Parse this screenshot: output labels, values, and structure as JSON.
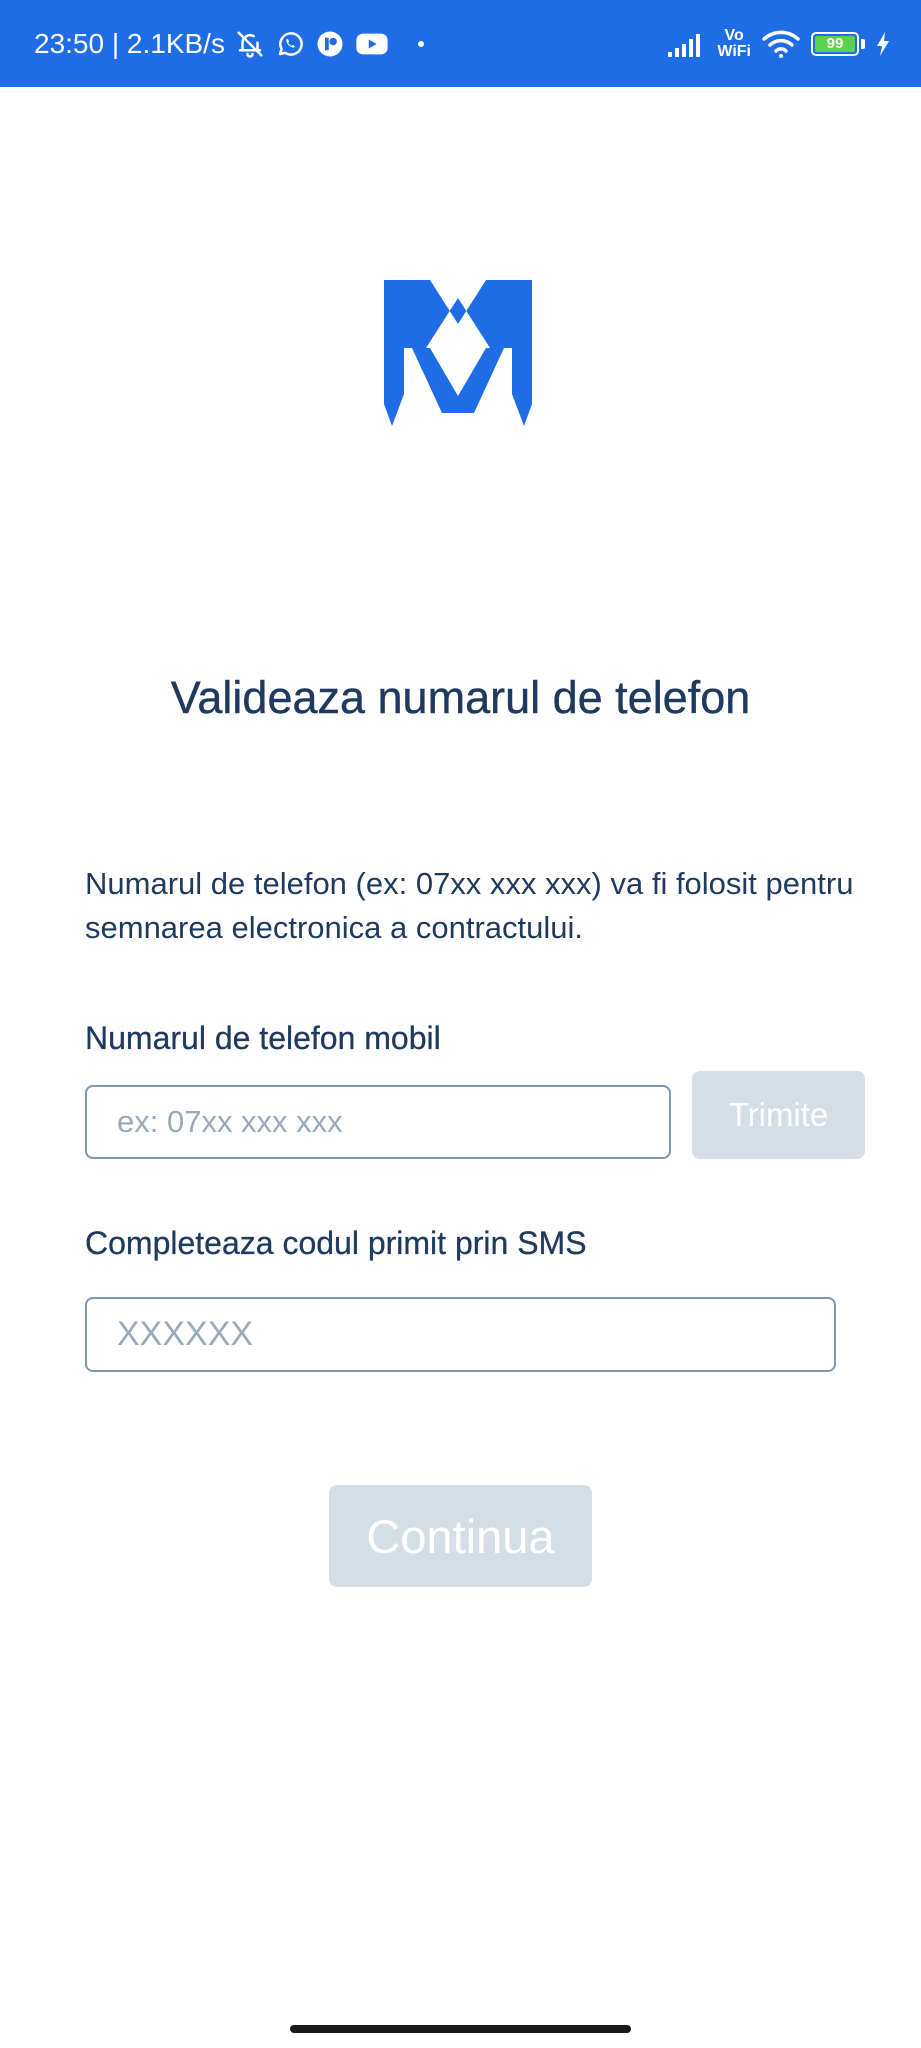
{
  "status_bar": {
    "time_speed": "23:50 | 2.1KB/s",
    "icons": [
      "bell-off-icon",
      "whatsapp-icon",
      "app-icon",
      "youtube-icon",
      "dot-icon"
    ],
    "vo_label": "Vo",
    "wifi_label": "WiFi",
    "battery_level": "99",
    "background_color": "#1f6de6"
  },
  "logo": {
    "icon": "m-logo-icon",
    "color": "#1f6de6"
  },
  "page": {
    "title": "Valideaza numarul de telefon",
    "description": "Numarul de telefon (ex: 07xx xxx xxx) va fi folosit pentru semnarea electronica a contractului."
  },
  "phone": {
    "label": "Numarul de telefon mobil",
    "placeholder": "ex: 07xx xxx xxx",
    "value": "",
    "send_button": "Trimite"
  },
  "sms": {
    "label": "Completeaza codul primit prin SMS",
    "placeholder": "XXXXXX",
    "value": ""
  },
  "continue_button": "Continua"
}
